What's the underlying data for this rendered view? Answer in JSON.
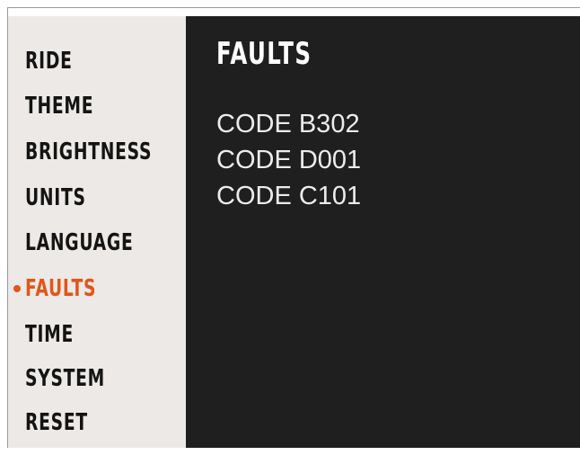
{
  "sidebar": {
    "items": [
      {
        "label": "RIDE",
        "active": false
      },
      {
        "label": "THEME",
        "active": false
      },
      {
        "label": "BRIGHTNESS",
        "active": false
      },
      {
        "label": "UNITS",
        "active": false
      },
      {
        "label": "LANGUAGE",
        "active": false
      },
      {
        "label": "FAULTS",
        "active": true
      },
      {
        "label": "TIME",
        "active": false
      },
      {
        "label": "SYSTEM",
        "active": false
      },
      {
        "label": "RESET",
        "active": false
      }
    ],
    "active_indicator_icon": "bullet-dot-icon"
  },
  "main": {
    "title": "FAULTS",
    "codes": [
      "CODE B302",
      "CODE D001",
      "CODE C101"
    ]
  },
  "colors": {
    "sidebar_bg": "#ece9e6",
    "main_bg": "#1f1f1f",
    "accent": "#e0561b",
    "menu_text": "#141414",
    "main_text": "#ffffff"
  }
}
